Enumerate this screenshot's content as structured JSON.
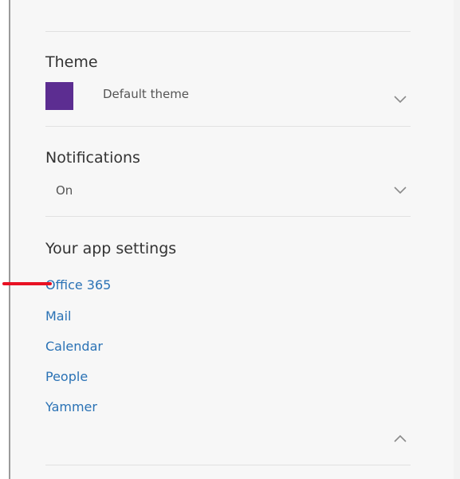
{
  "colors": {
    "theme_swatch": "#5c2d91",
    "link": "#2a72b5",
    "annotation": "#e81123"
  },
  "theme": {
    "heading": "Theme",
    "selected": "Default theme",
    "chevron_icon": "chevron-down-icon"
  },
  "notifications": {
    "heading": "Notifications",
    "selected": "On",
    "chevron_icon": "chevron-down-icon"
  },
  "app_settings": {
    "heading": "Your app settings",
    "links": [
      "Office 365",
      "Mail",
      "Calendar",
      "People",
      "Yammer"
    ],
    "collapse_icon": "chevron-up-icon"
  },
  "annotation": {
    "icon": "red-arrow-annotation"
  }
}
